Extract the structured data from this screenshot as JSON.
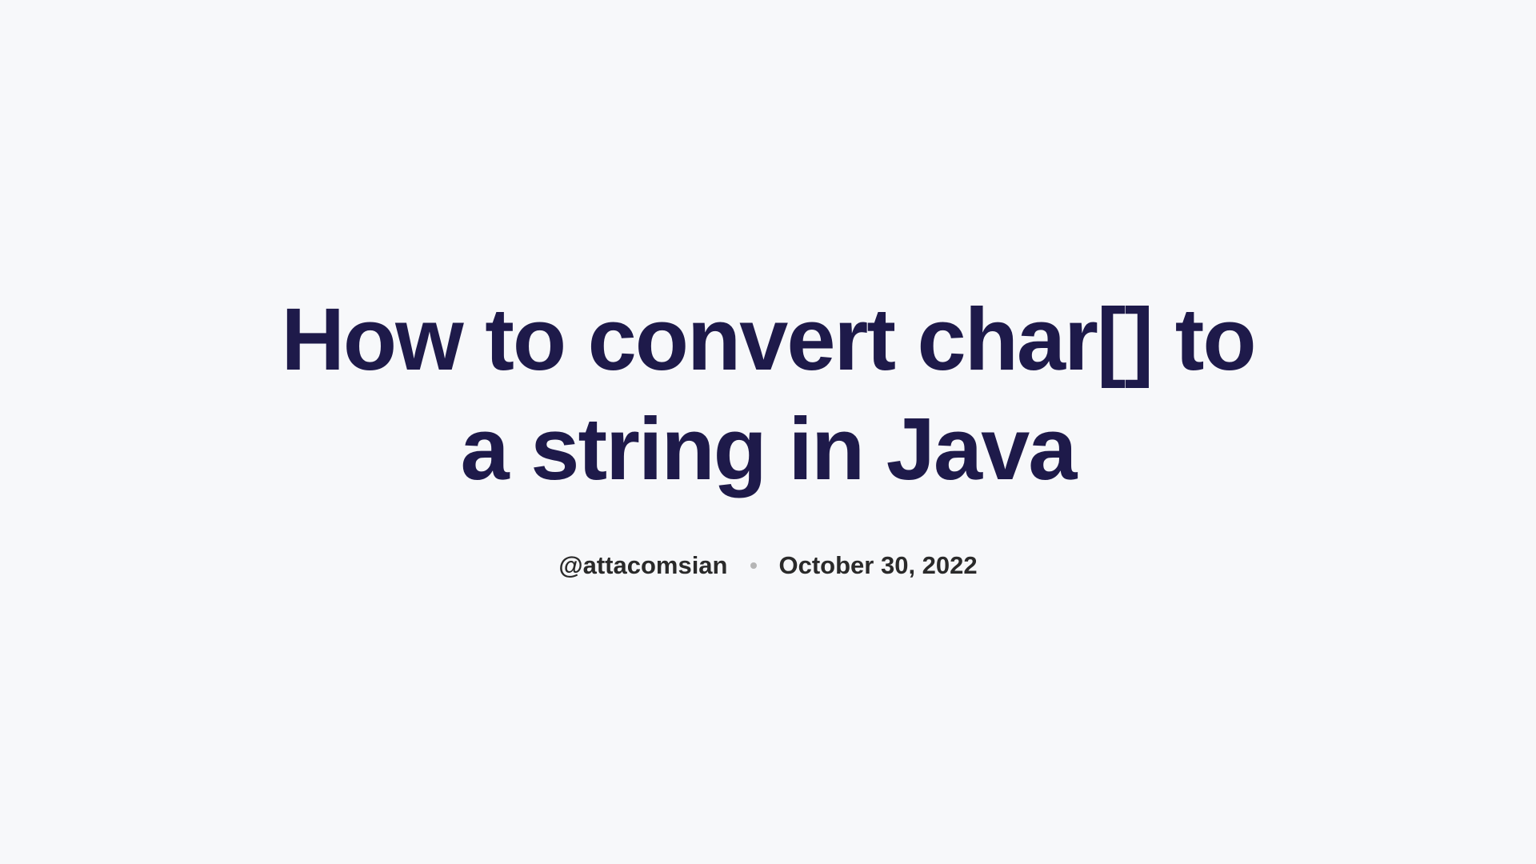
{
  "title": "How to convert char[] to a string in Java",
  "author": "@attacomsian",
  "date": "October 30, 2022"
}
